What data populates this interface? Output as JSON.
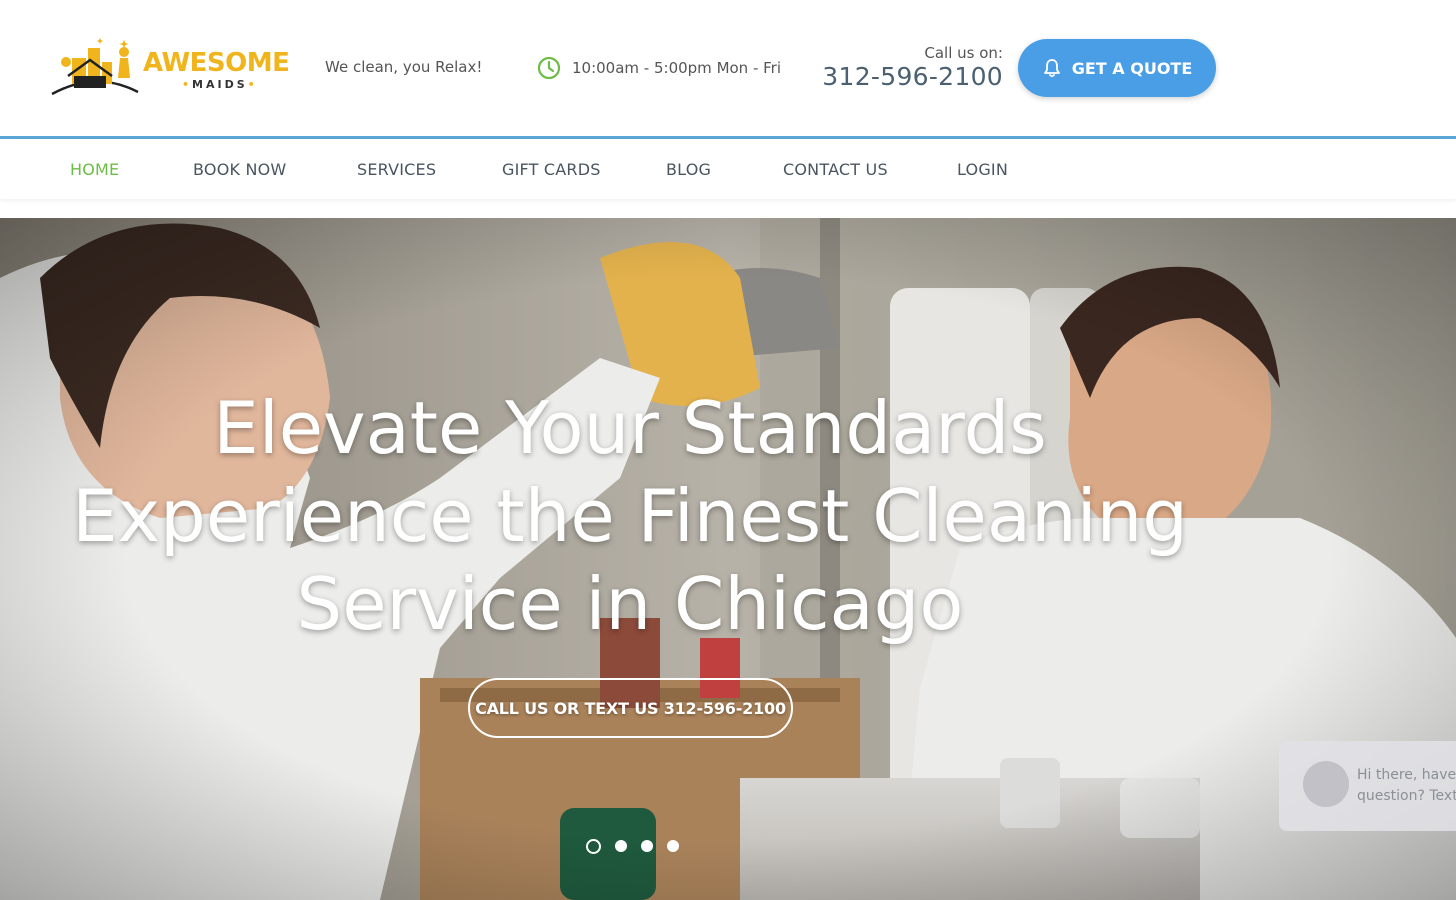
{
  "header": {
    "logo_word": "AWESOME",
    "logo_sub": "MAIDS",
    "tagline": "We clean, you Relax!",
    "hours": "10:00am - 5:00pm Mon - Fri",
    "call_label": "Call us on:",
    "phone": "312-596-2100",
    "quote_button": "GET A QUOTE"
  },
  "nav": {
    "items": [
      {
        "label": "HOME",
        "active": true
      },
      {
        "label": "BOOK NOW"
      },
      {
        "label": "SERVICES"
      },
      {
        "label": "GIFT CARDS"
      },
      {
        "label": "BLOG"
      },
      {
        "label": "CONTACT US"
      },
      {
        "label": "LOGIN"
      }
    ]
  },
  "hero": {
    "title_line1": "Elevate Your Standards",
    "title_line2": "Experience the Finest Cleaning",
    "title_line3": "Service in Chicago",
    "cta": "CALL US OR TEXT US 312-596-2100",
    "slides_count": 4,
    "active_slide": 1
  },
  "chat": {
    "line1": "Hi there, have a",
    "line2": "question? Text"
  },
  "colors": {
    "accent_blue": "#4a9ee6",
    "nav_active_green": "#6cbd45",
    "brand_yellow": "#f0b41c",
    "divider_blue": "#58a7d6"
  }
}
